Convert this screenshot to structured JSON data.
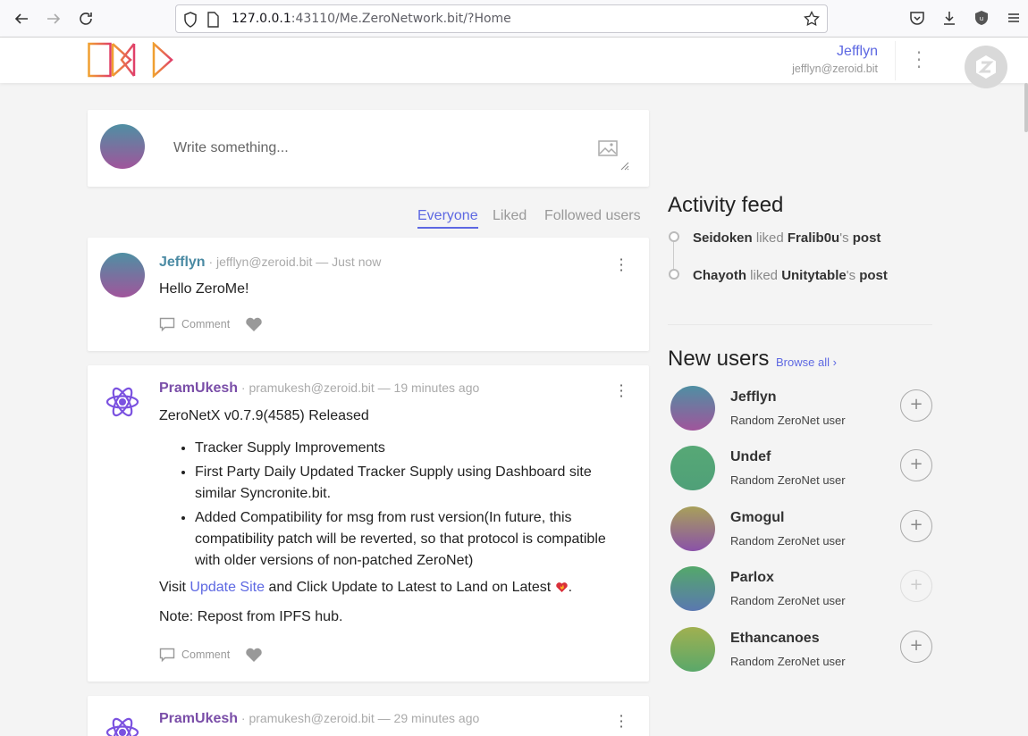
{
  "browser": {
    "url_prefix": "127.0.0.1",
    "url_rest": ":43110/Me.ZeroNetwork.bit/?Home"
  },
  "header": {
    "user_name": "Jefflyn",
    "user_address": "jefflyn@zeroid.bit"
  },
  "compose": {
    "placeholder": "Write something..."
  },
  "tabs": [
    {
      "label": "Everyone",
      "active": true
    },
    {
      "label": "Liked",
      "active": false
    },
    {
      "label": "Followed users",
      "active": false
    }
  ],
  "posts": [
    {
      "name": "Jefflyn",
      "meta": " · jefflyn@zeroid.bit — Just now",
      "text": "Hello ZeroMe!",
      "comment_label": "Comment"
    },
    {
      "name": "PramUkesh",
      "meta": " · pramukesh@zeroid.bit — 19 minutes ago",
      "title": "ZeroNetX v0.7.9(4585) Released",
      "bullets": [
        "Tracker Supply Improvements",
        "First Party Daily Updated Tracker Supply using Dashboard site similar Syncronite.bit.",
        "Added Compatibility for msg from rust version(In future, this compatibility patch will be reverted, so that protocol is compatible with older versions of non-patched ZeroNet)"
      ],
      "visit_prefix": "Visit ",
      "link_text": "Update Site",
      "visit_suffix": " and Click Update to Latest to Land on Latest ",
      "visit_end": ".",
      "note": "Note: Repost from IPFS hub.",
      "comment_label": "Comment"
    },
    {
      "name": "PramUkesh",
      "meta": " · pramukesh@zeroid.bit — 29 minutes ago"
    }
  ],
  "activity": {
    "title": "Activity feed",
    "items": [
      {
        "actor": "Seidoken",
        "verb": " liked ",
        "target": "Fralib0u",
        "suffix": "'s ",
        "object": "post"
      },
      {
        "actor": "Chayoth",
        "verb": " liked ",
        "target": "Unitytable",
        "suffix": "'s ",
        "object": "post"
      }
    ]
  },
  "new_users": {
    "title": "New users",
    "browse_label": "Browse all ›",
    "users": [
      {
        "name": "Jefflyn",
        "desc": "Random ZeroNet user",
        "color_top": "#4f8fa3",
        "color_bottom": "#a0559b"
      },
      {
        "name": "Undef",
        "desc": "Random ZeroNet user",
        "color_top": "#57a876",
        "color_bottom": "#4fa078"
      },
      {
        "name": "Gmogul",
        "desc": "Random ZeroNet user",
        "color_top": "#a8a05a",
        "color_bottom": "#8a52a8"
      },
      {
        "name": "Parlox",
        "desc": "Random ZeroNet user",
        "color_top": "#54a86a",
        "color_bottom": "#5a78b0"
      },
      {
        "name": "Ethancanoes",
        "desc": "Random ZeroNet user",
        "color_top": "#a0b050",
        "color_bottom": "#5aa86a"
      }
    ]
  },
  "colors": {
    "accent": "#5d68e2",
    "teal_name": "#4a8aa3",
    "purple_name": "#7a4ea8"
  }
}
